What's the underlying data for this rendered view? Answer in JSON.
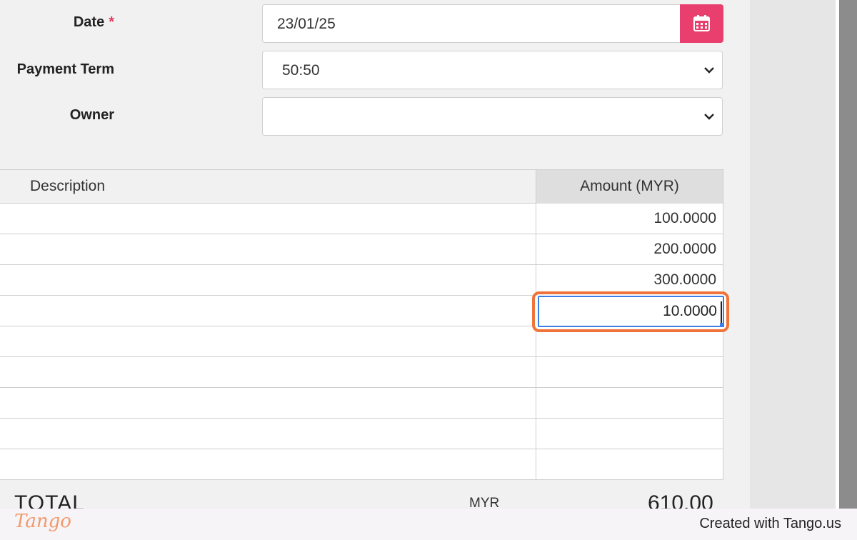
{
  "form": {
    "date": {
      "label": "Date",
      "required_mark": "*",
      "value": "23/01/25"
    },
    "payment_term": {
      "label": "Payment Term",
      "value": "50:50"
    },
    "owner": {
      "label": "Owner",
      "value": ""
    }
  },
  "table": {
    "headers": {
      "description": "Description",
      "amount": "Amount (MYR)"
    },
    "rows": [
      {
        "description": "",
        "amount": "100.0000"
      },
      {
        "description": "",
        "amount": "200.0000"
      },
      {
        "description": "",
        "amount": "300.0000"
      },
      {
        "description": "",
        "amount": "10.0000"
      },
      {
        "description": "",
        "amount": ""
      },
      {
        "description": "",
        "amount": ""
      },
      {
        "description": "",
        "amount": ""
      },
      {
        "description": "",
        "amount": ""
      },
      {
        "description": "",
        "amount": ""
      }
    ],
    "active_row": 3
  },
  "total": {
    "label": "TOTAL",
    "currency": "MYR",
    "value": "610.00"
  },
  "footer": {
    "logo": "Tango",
    "credit": "Created with Tango.us"
  },
  "colors": {
    "accent": "#e83f6f",
    "highlight": "#f0733a",
    "focus": "#3a7ee8"
  },
  "icons": {
    "calendar": "calendar-icon",
    "dropdown": "chevron-down-icon"
  }
}
